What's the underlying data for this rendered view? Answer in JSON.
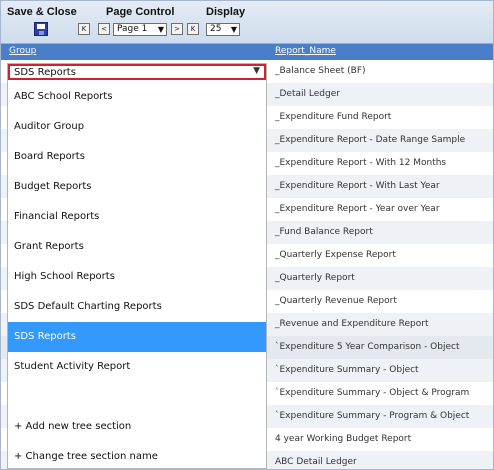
{
  "toolbar": {
    "save_close": "Save & Close",
    "page_control": "Page Control",
    "display": "Display",
    "first": "K",
    "prev": "<",
    "next": ">",
    "last": "K",
    "page_value": "Page 1",
    "display_value": "25"
  },
  "grid": {
    "header_group": "Group",
    "header_report": "Report_Name",
    "rows": [
      "_Balance Sheet (BF)",
      "_Detail Ledger",
      "_Expenditure Fund Report",
      "_Expenditure Report - Date Range Sample",
      "_Expenditure Report - With 12 Months",
      "_Expenditure Report - With Last Year",
      "_Expenditure Report - Year over Year",
      "_Fund Balance Report",
      "_Quarterly Expense Report",
      "_Quarterly Report",
      "_Quarterly Revenue Report",
      "_Revenue and Expenditure Report",
      "`Expenditure 5 Year Comparison - Object",
      "`Expenditure Summary - Object",
      "`Expenditure Summary - Object & Program",
      "`Expenditure Summary - Program & Object",
      "4 year Working Budget Report",
      "ABC Detail Ledger"
    ]
  },
  "dropdown": {
    "selected": "SDS Reports",
    "options": [
      "ABC School Reports",
      "Auditor Group",
      "Board Reports",
      "Budget Reports",
      "Financial Reports",
      "Grant Reports",
      "High School Reports",
      "SDS Default Charting Reports",
      "SDS Reports",
      "Student Activity Report"
    ],
    "highlighted_index": 8,
    "add_section": "+ Add new tree section",
    "change_section": "+ Change tree section name"
  },
  "colors": {
    "header": "#4a7ec9",
    "highlight": "#3399ff",
    "field_border": "#cc2233"
  }
}
